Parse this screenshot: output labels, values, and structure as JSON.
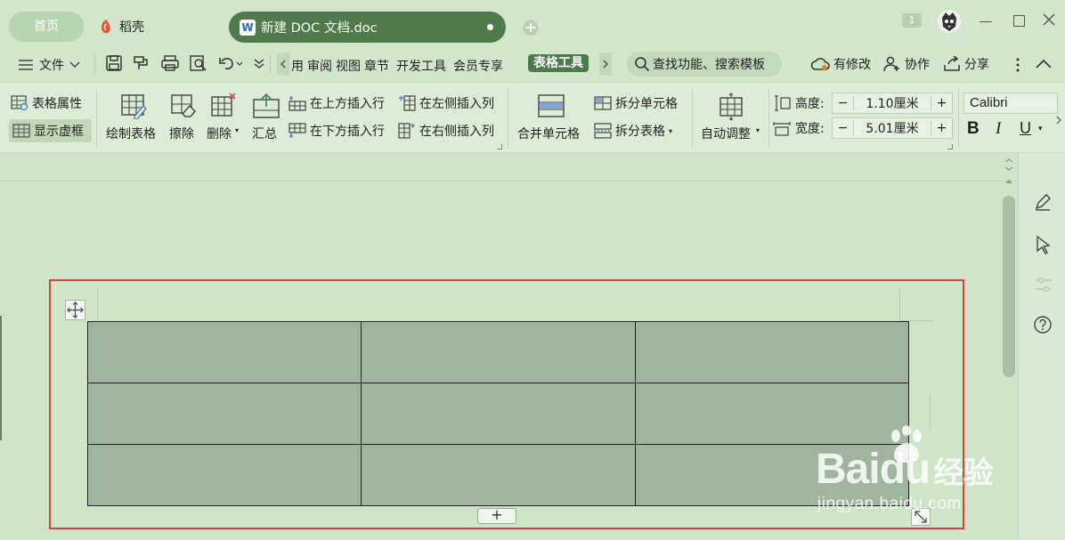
{
  "titlebar": {
    "home_tab": "首页",
    "daoke_tab": "稻壳",
    "doc_tab": "新建 DOC 文档.doc",
    "badge": "1"
  },
  "menubar": {
    "file": "文件",
    "items": [
      "用",
      "审阅",
      "视图",
      "章节",
      "开发工具",
      "会员专享"
    ],
    "table_tools": "表格工具",
    "search_placeholder": "查找功能、搜索模板",
    "modified": "有修改",
    "collaborate": "协作",
    "share": "分享"
  },
  "ribbon": {
    "table_props": "表格属性",
    "show_gridlines": "显示虚框",
    "draw_table": "绘制表格",
    "erase": "擦除",
    "delete": "删除",
    "summary": "汇总",
    "insert_above": "在上方插入行",
    "insert_below": "在下方插入行",
    "insert_left": "在左侧插入列",
    "insert_right": "在右侧插入列",
    "merge_cells": "合并单元格",
    "split_cells": "拆分单元格",
    "split_table": "拆分表格",
    "auto_fit": "自动调整",
    "height_label": "高度:",
    "height_value": "1.10厘米",
    "width_label": "宽度:",
    "width_value": "5.01厘米",
    "font_name": "Calibri",
    "bold": "B",
    "italic": "I",
    "underline": "U"
  },
  "table": {
    "rows": 3,
    "cols": 3,
    "add_row_label": "+"
  },
  "watermark": {
    "brand": "Baidu",
    "cn": "经验",
    "url": "jingyan.baidu.com"
  },
  "colors": {
    "accent": "#4e7a4c",
    "highlight": "#e0403a",
    "cell_fill": "#9fb59d"
  }
}
